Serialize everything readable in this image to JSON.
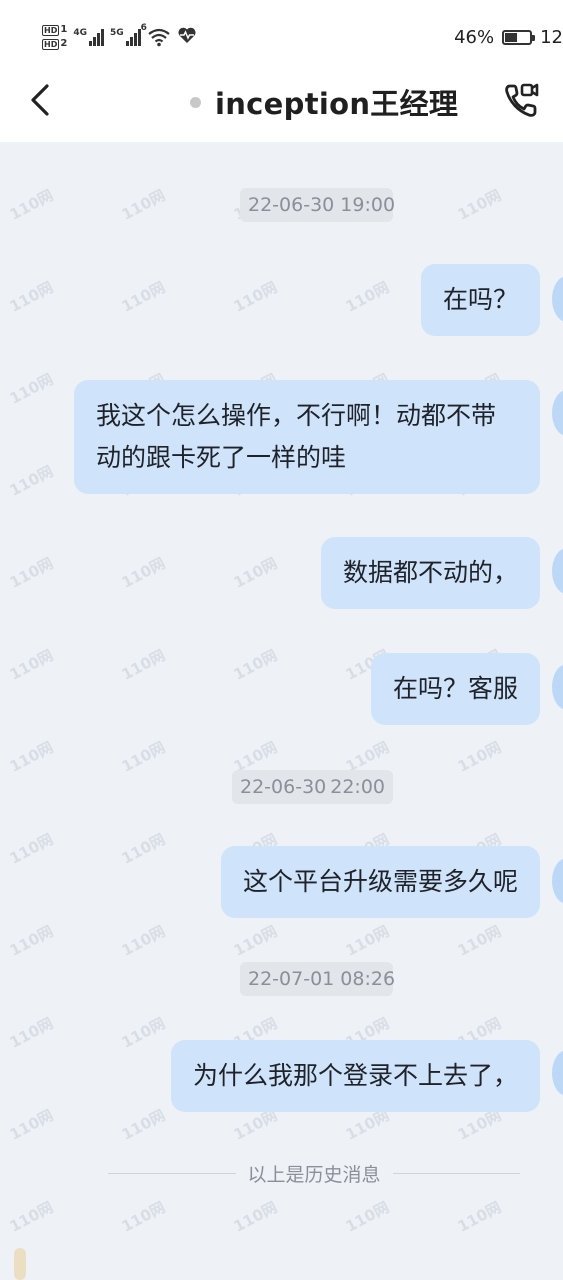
{
  "status_bar": {
    "hd1": "HD",
    "hd1_sub": "1",
    "hd2": "HD",
    "hd2_sub": "2",
    "net1": "4G",
    "net2": "5G",
    "wifi_badge": "6",
    "battery_percent": "46%",
    "battery_level": 0.46,
    "clock_partial": "12"
  },
  "header": {
    "back_icon": "chevron-left-icon",
    "title": "inception王经理",
    "call_icon": "video-call-icon"
  },
  "messages": [
    {
      "type": "time",
      "text": "22-06-30 19:00"
    },
    {
      "type": "sent",
      "text": "在吗？"
    },
    {
      "type": "sent",
      "text": "我这个怎么操作，不行啊！动都不带动的跟卡死了一样的哇"
    },
    {
      "type": "sent",
      "text": "数据都不动的，"
    },
    {
      "type": "sent",
      "text": "在吗？客服"
    },
    {
      "type": "time",
      "text": "22-06-30",
      "text2": "22:00"
    },
    {
      "type": "sent",
      "text": "这个平台升级需要多久呢"
    },
    {
      "type": "time",
      "text": "22-07-01 08:26"
    },
    {
      "type": "sent",
      "text": "为什么我那个登录不上去了，"
    }
  ],
  "history_divider": "以上是历史消息",
  "watermark": "110网",
  "colors": {
    "background": "#eef1f6",
    "bubble_sent": "#cfe3fb",
    "header_bg": "#ffffff",
    "time_chip": "#e2e5ea"
  }
}
